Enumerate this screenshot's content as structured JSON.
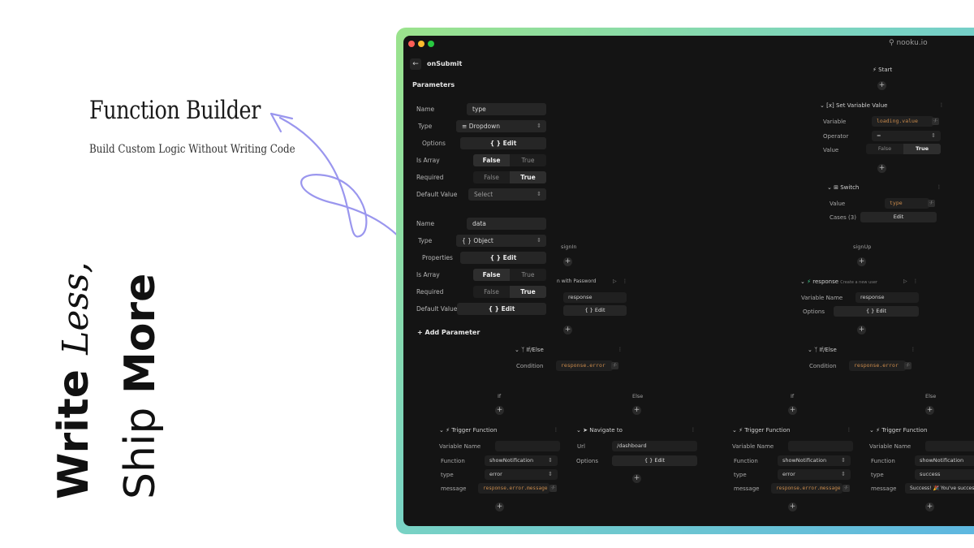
{
  "hero": {
    "title": "Function Builder",
    "subtitle": "Build Custom Logic Without Writing Code",
    "tagline_write": "Write",
    "tagline_less": "Less,",
    "tagline_ship": "Ship",
    "tagline_more": "More"
  },
  "window": {
    "url": "nooku.io"
  },
  "panel": {
    "back_icon": "arrow-left-icon",
    "title": "onSubmit",
    "section": "Parameters",
    "param1": {
      "name_label": "Name",
      "name_value": "type",
      "type_label": "Type",
      "type_value": "Dropdown",
      "options_label": "Options",
      "options_btn": "Edit",
      "isarray_label": "Is Array",
      "false": "False",
      "true": "True",
      "required_label": "Required",
      "default_label": "Default Value",
      "default_value": "Select"
    },
    "param2": {
      "name_label": "Name",
      "name_value": "data",
      "type_label": "Type",
      "type_value": "Object",
      "properties_label": "Properties",
      "properties_btn": "Edit",
      "isarray_label": "Is Array",
      "false": "False",
      "true": "True",
      "required_label": "Required",
      "default_label": "Default Value",
      "default_btn": "Edit"
    },
    "add_param": "Add Parameter"
  },
  "canvas": {
    "start": "Start",
    "setvar": {
      "title": "Set Variable Value",
      "variable_label": "Variable",
      "variable_value": "loading.value",
      "operator_label": "Operator",
      "operator_value": "=",
      "value_label": "Value",
      "false": "False",
      "true": "True"
    },
    "switch": {
      "title": "Switch",
      "value_label": "Value",
      "value_value": "type",
      "cases_label": "Cases (3)",
      "cases_btn": "Edit"
    },
    "signin": "signIn",
    "signup": "signUp",
    "signin_node": {
      "title": "n with Password",
      "value": "response",
      "edit": "Edit"
    },
    "response_node": {
      "title": "response",
      "subtitle": "Create a new user",
      "varname_label": "Variable Name",
      "varname_value": "response",
      "options_label": "Options",
      "options_btn": "Edit"
    },
    "ifelse_left": {
      "title": "If/Else",
      "condition_label": "Condition",
      "condition_value": "response.error"
    },
    "ifelse_right": {
      "title": "If/Else",
      "condition_label": "Condition",
      "condition_value": "response.error"
    },
    "branches": {
      "if": "If",
      "else": "Else"
    },
    "trigger1": {
      "title": "Trigger Function",
      "varname_label": "Variable Name",
      "function_label": "Function",
      "function_value": "showNotification",
      "type_label": "type",
      "type_value": "error",
      "message_label": "message",
      "message_value": "response.error.message"
    },
    "navigate": {
      "title": "Navigate to",
      "url_label": "Url",
      "url_value": "/dashboard",
      "options_label": "Options",
      "options_btn": "Edit"
    },
    "trigger2": {
      "title": "Trigger Function",
      "varname_label": "Variable Name",
      "function_label": "Function",
      "function_value": "showNotification",
      "type_label": "type",
      "type_value": "error",
      "message_label": "message",
      "message_value": "response.error.message"
    },
    "trigger3": {
      "title": "Trigger Function",
      "varname_label": "Variable Name",
      "function_label": "Function",
      "function_value": "showNotification",
      "type_label": "type",
      "type_value": "success",
      "message_label": "message",
      "message_value": "Success! 🎉 You've successfully"
    }
  },
  "colors": {
    "accent": "#9a96ee",
    "window_bg": "#141414",
    "frame_green": "#9be38c",
    "frame_blue": "#5eb7e0"
  }
}
